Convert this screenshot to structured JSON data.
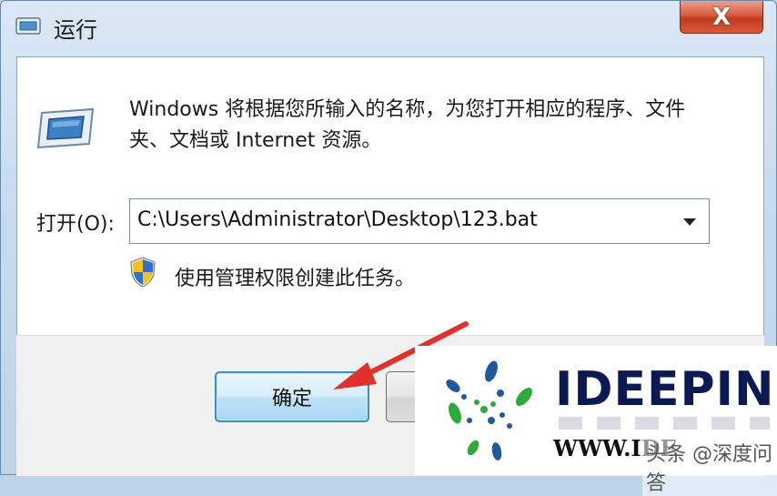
{
  "window": {
    "title": "运行",
    "close_label": "X"
  },
  "body": {
    "description": "Windows 将根据您所输入的名称，为您打开相应的程序、文件夹、文档或 Internet 资源。",
    "open_label": "打开(O):",
    "command_value": "C:\\Users\\Administrator\\Desktop\\123.bat",
    "admin_note": "使用管理权限创建此任务。"
  },
  "buttons": {
    "ok": "确定"
  },
  "watermark": {
    "brand": "IDEEPIN",
    "site": "WWW.IDE",
    "credit": "头条 @深度问答"
  },
  "colors": {
    "accent": "#3a8fc4",
    "close_red": "#c33a1d",
    "arrow_red": "#e0312b",
    "brand_navy": "#0b1a52",
    "logo_green": "#2eaa3a",
    "logo_blue": "#1f5aa0"
  },
  "icons": {
    "title": "run-icon",
    "dialog": "run-icon",
    "shield": "uac-shield-icon",
    "combo": "chevron-down-icon"
  }
}
